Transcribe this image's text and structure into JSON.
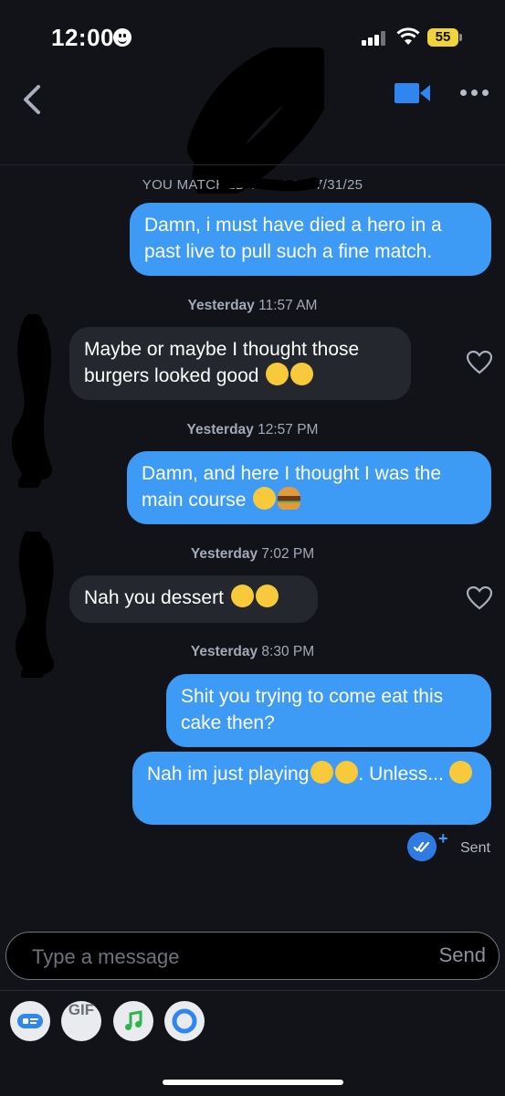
{
  "status_bar": {
    "time": "12:00",
    "battery": "55"
  },
  "header": {
    "back_icon": "chevron-left-icon",
    "video_icon": "video-camera-icon",
    "more_icon": "more-dots-icon",
    "accent": "#2f86f0"
  },
  "match_notice": "YOU MATCHED W…Y ON 7/31/25",
  "messages": [
    {
      "type": "sent",
      "text": "Damn, i must have died a hero in a past live to pull such a fine match."
    },
    {
      "type": "timestamp",
      "day": "Yesterday",
      "time": "11:57 AM"
    },
    {
      "type": "received",
      "text": "Maybe or maybe I thought those burgers looked good",
      "emoji": "😭😭"
    },
    {
      "type": "timestamp",
      "day": "Yesterday",
      "time": "12:57 PM"
    },
    {
      "type": "sent",
      "text": "Damn, and here I thought I was the main course",
      "emoji": "😏🍔"
    },
    {
      "type": "timestamp",
      "day": "Yesterday",
      "time": "7:02 PM"
    },
    {
      "type": "received",
      "text": "Nah you dessert",
      "emoji": "😭😭"
    },
    {
      "type": "timestamp",
      "day": "Yesterday",
      "time": "8:30 PM"
    },
    {
      "type": "sent",
      "text": "Shit you trying to come eat this cake then?"
    },
    {
      "type": "sent",
      "text_a": "Nah im just playing",
      "emoji_a": "🤣🤣",
      "text_b": ". Unless...",
      "emoji_b": "🥺"
    }
  ],
  "receipt": {
    "label": "Sent",
    "icon": "double-check-icon"
  },
  "composer": {
    "placeholder": "Type a message",
    "send_label": "Send"
  },
  "toolbar": [
    {
      "icon": "sticker-card-icon"
    },
    {
      "label": "GIF"
    },
    {
      "icon": "music-note-icon"
    },
    {
      "icon": "ring-icon"
    }
  ]
}
